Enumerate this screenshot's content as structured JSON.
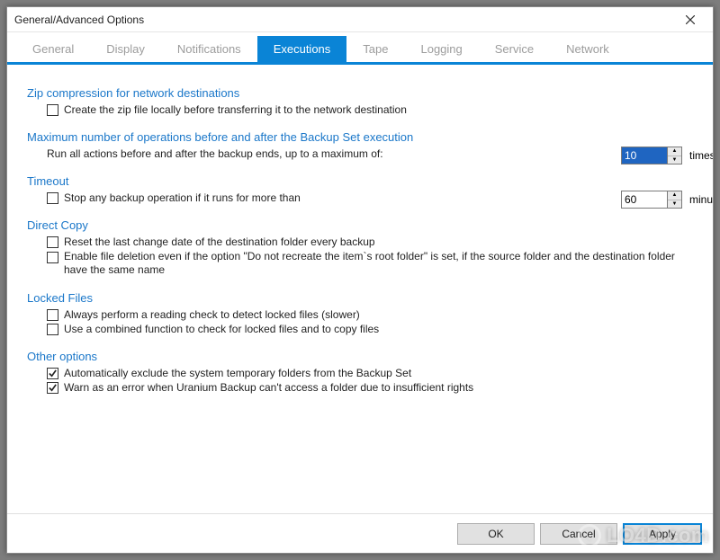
{
  "window": {
    "title": "General/Advanced Options"
  },
  "tabs": {
    "items": [
      {
        "label": "General",
        "active": false
      },
      {
        "label": "Display",
        "active": false
      },
      {
        "label": "Notifications",
        "active": false
      },
      {
        "label": "Executions",
        "active": true
      },
      {
        "label": "Tape",
        "active": false
      },
      {
        "label": "Logging",
        "active": false
      },
      {
        "label": "Service",
        "active": false
      },
      {
        "label": "Network",
        "active": false
      }
    ]
  },
  "sections": {
    "zip": {
      "title": "Zip compression for network destinations",
      "opt_local": {
        "checked": false,
        "label": "Create the zip file locally before transferring it to the network destination"
      }
    },
    "maxops": {
      "title": "Maximum number of operations before and after the Backup Set execution",
      "label": "Run all actions before and after the backup ends, up to a maximum of:",
      "value": "10",
      "unit": "times"
    },
    "timeout": {
      "title": "Timeout",
      "opt_stop": {
        "checked": false,
        "label": "Stop any backup operation if it runs for more than"
      },
      "value": "60",
      "unit": "minutes"
    },
    "directcopy": {
      "title": "Direct Copy",
      "opt_reset": {
        "checked": false,
        "label": "Reset the last change date of the destination folder every backup"
      },
      "opt_enable_delete": {
        "checked": false,
        "label": "Enable file deletion even if the option \"Do not recreate the item`s root folder\" is set, if the source folder and the destination folder have the same name"
      }
    },
    "locked": {
      "title": "Locked Files",
      "opt_readcheck": {
        "checked": false,
        "label": "Always perform a reading check to detect locked files (slower)"
      },
      "opt_combined": {
        "checked": false,
        "label": "Use a combined function to check for locked files and to copy files"
      }
    },
    "other": {
      "title": "Other options",
      "opt_exclude_temp": {
        "checked": true,
        "label": "Automatically exclude the system temporary folders from the Backup Set"
      },
      "opt_warn_rights": {
        "checked": true,
        "label": "Warn as an error when Uranium Backup can't access a folder due to insufficient rights"
      }
    }
  },
  "buttons": {
    "ok": "OK",
    "cancel": "Cancel",
    "apply": "Apply"
  },
  "watermark": "LO4D.com"
}
